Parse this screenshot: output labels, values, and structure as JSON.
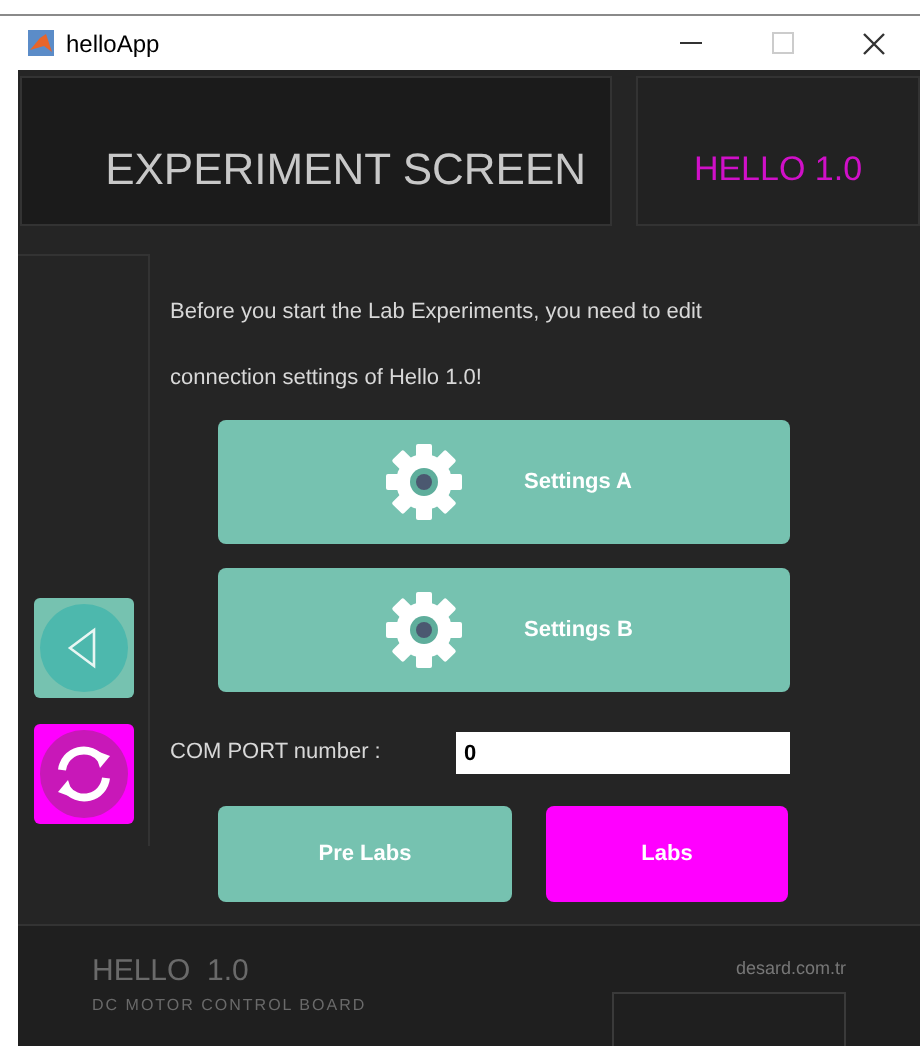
{
  "window": {
    "title": "helloApp"
  },
  "header": {
    "title": "EXPERIMENT SCREEN",
    "brand": "HELLO 1.0"
  },
  "message": "Before you start the Lab Experiments, you need to edit connection settings of Hello 1.0!",
  "settings_buttons": [
    {
      "label": "Settings A"
    },
    {
      "label": "Settings B"
    }
  ],
  "com_port": {
    "label": "COM PORT number :",
    "value": "0"
  },
  "lab_buttons": [
    {
      "label": "Pre Labs",
      "color": "#76c2b0"
    },
    {
      "label": "Labs",
      "color": "#ff00ff"
    }
  ],
  "footer": {
    "title": "HELLO  1.0",
    "subtitle": "DC MOTOR CONTROL BOARD",
    "website": "desard.com.tr"
  }
}
